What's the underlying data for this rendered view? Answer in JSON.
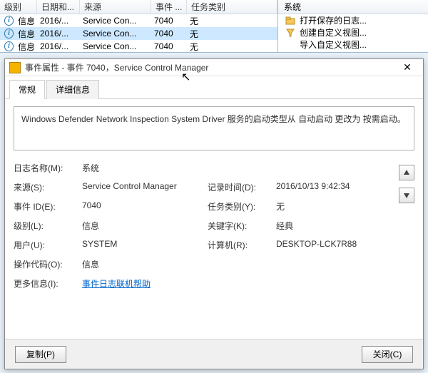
{
  "grid": {
    "headers": [
      "级别",
      "日期和...",
      "来源",
      "事件 ...",
      "任务类别"
    ],
    "rows": [
      {
        "level": "信息",
        "date": "2016/...",
        "source": "Service Con...",
        "eventid": "7040",
        "task": "无"
      },
      {
        "level": "信息",
        "date": "2016/...",
        "source": "Service Con...",
        "eventid": "7040",
        "task": "无"
      },
      {
        "level": "信息",
        "date": "2016/...",
        "source": "Service Con...",
        "eventid": "7040",
        "task": "无"
      }
    ]
  },
  "actions": {
    "header": "系统",
    "items": [
      {
        "icon": "folder",
        "label": "打开保存的日志..."
      },
      {
        "icon": "filter",
        "label": "创建自定义视图..."
      },
      {
        "icon": "import",
        "label": "导入自定义视图..."
      }
    ]
  },
  "dialog": {
    "title": "事件属性 - 事件 7040，Service Control Manager",
    "tabs": {
      "general": "常规",
      "details": "详细信息"
    },
    "message": "Windows Defender Network Inspection System Driver 服务的启动类型从 自动启动 更改为 按需启动。",
    "labels": {
      "logname": "日志名称(M):",
      "source": "来源(S):",
      "eventid": "事件 ID(E):",
      "level": "级别(L):",
      "user": "用户(U):",
      "opcode": "操作代码(O):",
      "moreinfo": "更多信息(I):",
      "logged": "记录时间(D):",
      "taskcat": "任务类别(Y):",
      "keywords": "关键字(K):",
      "computer": "计算机(R):"
    },
    "values": {
      "logname": "系统",
      "source": "Service Control Manager",
      "eventid": "7040",
      "level": "信息",
      "user": "SYSTEM",
      "opcode": "信息",
      "moreinfo": "事件日志联机帮助",
      "logged": "2016/10/13 9:42:34",
      "taskcat": "无",
      "keywords": "经典",
      "computer": "DESKTOP-LCK7R88"
    },
    "buttons": {
      "copy": "复制(P)",
      "close": "关闭(C)"
    }
  }
}
